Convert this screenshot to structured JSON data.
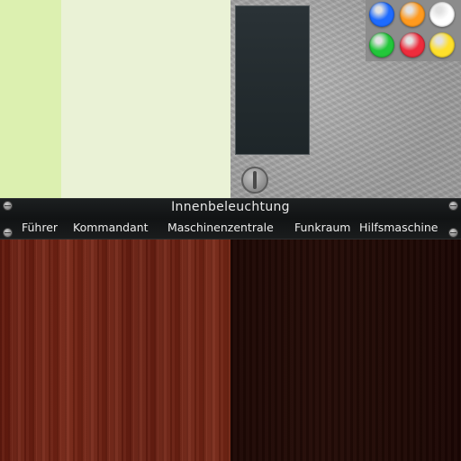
{
  "colors": {
    "swatch_green": "#dcf0b0",
    "swatch_pale": "#eaf2d6",
    "screen": "#232b2e",
    "wood_light": "#6e2012",
    "wood_dark": "#200905"
  },
  "lamps": [
    {
      "name": "blue",
      "color": "#1e6bff"
    },
    {
      "name": "orange",
      "color": "#ff9a1e"
    },
    {
      "name": "white",
      "color": "#ffffff"
    },
    {
      "name": "green",
      "color": "#22c73a"
    },
    {
      "name": "red",
      "color": "#ee2c3c"
    },
    {
      "name": "yellow",
      "color": "#ffe02a"
    }
  ],
  "label_strip": {
    "title": "Innenbeleuchtung",
    "labels": [
      "Führer",
      "Kommandant",
      "Maschinenzentrale",
      "Funkraum",
      "Hilfsmaschine"
    ]
  },
  "icons": {
    "knob": "rotary-knob-icon",
    "screw": "screw-icon"
  }
}
